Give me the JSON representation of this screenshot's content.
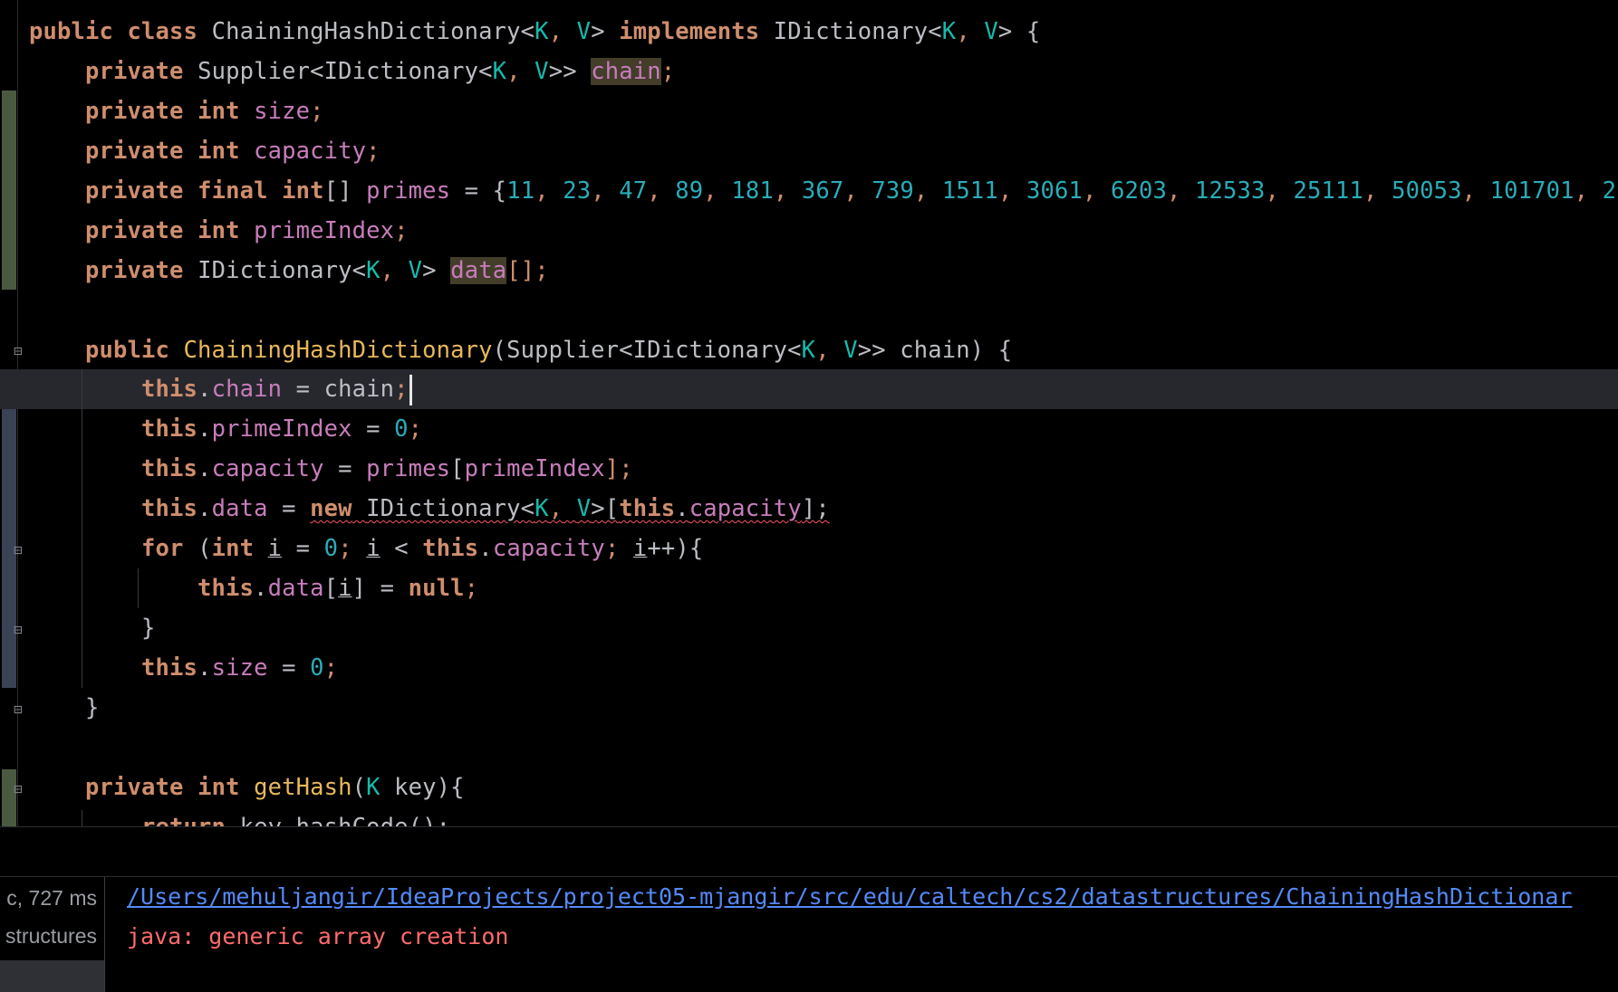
{
  "editor": {
    "lines": {
      "l1": {
        "t1": "public",
        "t2": "class",
        "t3": "ChainingHashDictionary<",
        "t4": "K",
        "t5": ",",
        "t6": "V",
        "t7": ">",
        "t8": "implements",
        "t9": "IDictionary<",
        "t10": "K",
        "t11": ",",
        "t12": "V",
        "t13": "> {"
      },
      "l2": {
        "t1": "private",
        "t2": "Supplier<IDictionary<",
        "t3": "K",
        "t4": ",",
        "t5": "V",
        "t6": ">>",
        "t7": "chain",
        "t8": ";"
      },
      "l3": {
        "t1": "private",
        "t2": "int",
        "t3": "size",
        "t4": ";"
      },
      "l4": {
        "t1": "private",
        "t2": "int",
        "t3": "capacity",
        "t4": ";"
      },
      "l5": {
        "t1": "private",
        "t2": "final",
        "t3": "int",
        "t4": "[]",
        "t5": "primes",
        "t6": "= {",
        "nums": [
          "11",
          "23",
          "47",
          "89",
          "181",
          "367",
          "739",
          "1511",
          "3061",
          "6203",
          "12533",
          "25111",
          "50053",
          "101701",
          "2"
        ]
      },
      "l6": {
        "t1": "private",
        "t2": "int",
        "t3": "primeIndex",
        "t4": ";"
      },
      "l7": {
        "t1": "private",
        "t2": "IDictionary<",
        "t3": "K",
        "t4": ",",
        "t5": "V",
        "t6": ">",
        "t7": "data",
        "t8": "[];"
      },
      "l9": {
        "t1": "public",
        "t2": "ChainingHashDictionary",
        "t3": "(Supplier<IDictionary<",
        "t4": "K",
        "t5": ",",
        "t6": "V",
        "t7": ">> chain) {"
      },
      "l10": {
        "t1": "this",
        "t2": ".",
        "t3": "chain",
        "t4": "= chain",
        "t5": ";"
      },
      "l11": {
        "t1": "this",
        "t2": ".",
        "t3": "primeIndex",
        "t4": "=",
        "t5": "0",
        "t6": ";"
      },
      "l12": {
        "t1": "this",
        "t2": ".",
        "t3": "capacity",
        "t4": "=",
        "t5": "primes",
        "t6": "[",
        "t7": "primeIndex",
        "t8": "];"
      },
      "l13": {
        "t1": "this",
        "t2": ".",
        "t3": "data",
        "t4": "=",
        "t5": "new",
        "t6": "IDictionary<",
        "t7": "K",
        "t8": ",",
        "t9": "V",
        "t10": ">[",
        "t11": "this",
        "t12": ".",
        "t13": "capacity",
        "t14": "];"
      },
      "l14": {
        "t1": "for",
        "t2": "(",
        "t3": "int",
        "t4": "i",
        "t5": "=",
        "t6": "0",
        "t7": ";",
        "t8": "i",
        "t9": "<",
        "t10": "this",
        "t11": ".",
        "t12": "capacity",
        "t13": ";",
        "t14": "i",
        "t15": "++){"
      },
      "l15": {
        "t1": "this",
        "t2": ".",
        "t3": "data",
        "t4": "[",
        "t5": "i",
        "t6": "] =",
        "t7": "null",
        "t8": ";"
      },
      "l16": {
        "t1": "}"
      },
      "l17": {
        "t1": "this",
        "t2": ".",
        "t3": "size",
        "t4": "=",
        "t5": "0",
        "t6": ";"
      },
      "l18": {
        "t1": "}"
      },
      "l20": {
        "t1": "private",
        "t2": "int",
        "t3": "getHash",
        "t4": "(",
        "t5": "K",
        "t6": "key){"
      },
      "l21": {
        "t1": "return",
        "t2": "key.hashCode();"
      }
    }
  },
  "build_output": {
    "left_items": [
      "c, 727 ms",
      "structures"
    ],
    "path": "/Users/mehuljangir/IdeaProjects/project05-mjangir/src/edu/caltech/cs2/datastructures/ChainingHashDictionar",
    "error": "java: generic array creation"
  },
  "colors": {
    "background": "#000000",
    "keyword": "#cf8e6d",
    "field": "#c77dbb",
    "number": "#2aacb8",
    "type_param": "#16baac",
    "method": "#e8b85b",
    "link": "#548af7",
    "error": "#ff6b6b"
  },
  "icons": [
    "fold-icon",
    "unfold-icon",
    "text-cursor"
  ]
}
